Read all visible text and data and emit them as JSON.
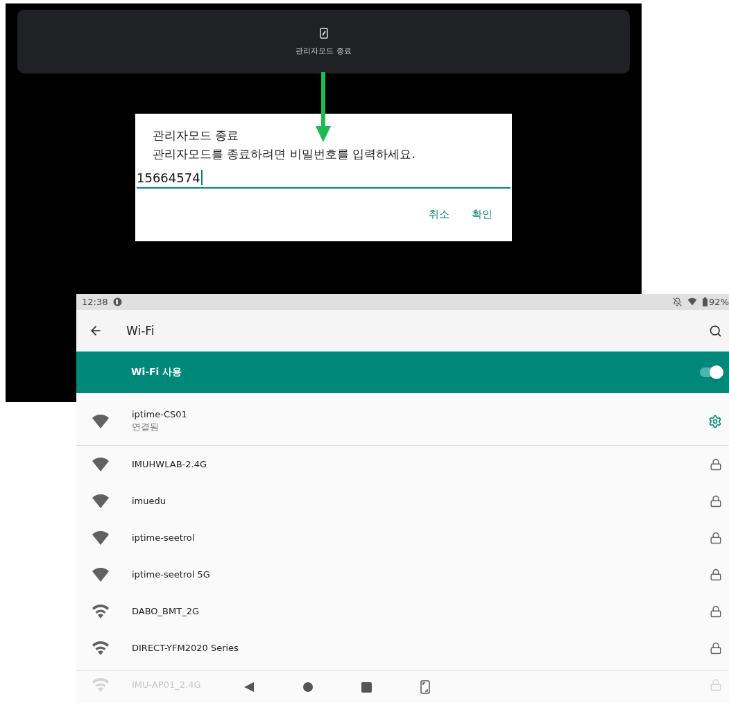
{
  "admin_panel": {
    "label": "관리자모드 종료"
  },
  "dialog": {
    "title": "관리자모드 종료",
    "message": "관리자모드를 종료하려면 비밀번호를 입력하세요.",
    "value": "15664574",
    "buttons": [
      "취소",
      "확인"
    ]
  },
  "status_bar": {
    "time": "12:38",
    "battery": "92%"
  },
  "toolbar": {
    "title": "Wi-Fi"
  },
  "wifi_switch": {
    "label": "Wi-Fi 사용",
    "on": true
  },
  "networks": [
    {
      "name": "iptime-CS01",
      "status": "연결됨",
      "kind": "connected",
      "weak_signal": false,
      "faded": false
    },
    {
      "name": "IMUHWLAB-2.4G",
      "kind": "locked",
      "weak_signal": false,
      "faded": false
    },
    {
      "name": "imuedu",
      "kind": "locked",
      "weak_signal": false,
      "faded": false
    },
    {
      "name": "iptime-seetrol",
      "kind": "locked",
      "weak_signal": false,
      "faded": false
    },
    {
      "name": "iptime-seetrol 5G",
      "kind": "locked",
      "weak_signal": false,
      "faded": false
    },
    {
      "name": "DABO_BMT_2G",
      "kind": "locked",
      "weak_signal": true,
      "faded": false
    },
    {
      "name": "DIRECT-YFM2020 Series",
      "kind": "locked",
      "weak_signal": true,
      "faded": false
    },
    {
      "name": "IMU-AP01_2.4G",
      "kind": "locked",
      "weak_signal": true,
      "faded": true
    }
  ]
}
